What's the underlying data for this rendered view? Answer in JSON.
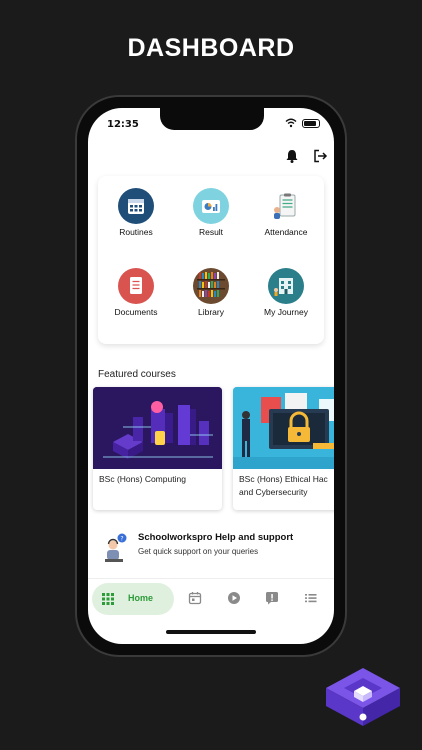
{
  "headline": "DASHBOARD",
  "status_bar": {
    "time": "12:35"
  },
  "top_actions": {
    "notification_icon": "bell-icon",
    "logout_icon": "logout-icon"
  },
  "menu": [
    {
      "label": "Routines",
      "icon": "calendar-icon",
      "color": "#1f4e79"
    },
    {
      "label": "Result",
      "icon": "result-chart-icon",
      "color": "#7fd3e0"
    },
    {
      "label": "Attendance",
      "icon": "clipboard-icon",
      "color": "#ffffff"
    },
    {
      "label": "Documents",
      "icon": "document-icon",
      "color": "#d9534f"
    },
    {
      "label": "Library",
      "icon": "bookshelf-icon",
      "color": "#6b4a2f"
    },
    {
      "label": "My Journey",
      "icon": "building-icon",
      "color": "#2a7f8a"
    }
  ],
  "featured": {
    "title": "Featured courses",
    "courses": [
      {
        "title": "BSc (Hons) Computing"
      },
      {
        "title": "BSc (Hons) Ethical Hac",
        "title_line2": "and Cybersecurity"
      }
    ]
  },
  "help": {
    "title": "Schoolworkspro Help and support",
    "subtitle": "Get quick support on your queries"
  },
  "nav": {
    "home_label": "Home",
    "active_color": "#2e9a3a",
    "active_bg": "#dff1de"
  }
}
